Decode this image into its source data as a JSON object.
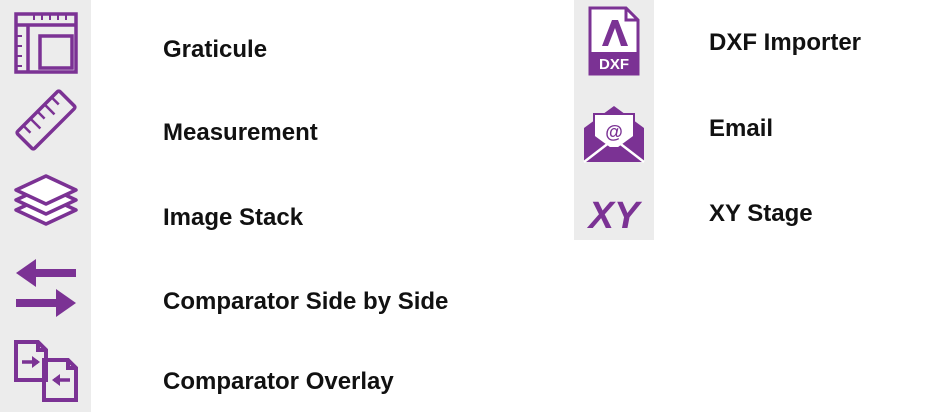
{
  "colors": {
    "accent": "#7b3294",
    "strip": "#ececec",
    "text": "#111111"
  },
  "left_tools": [
    {
      "icon": "graticule-icon",
      "label": "Graticule"
    },
    {
      "icon": "ruler-icon",
      "label": "Measurement"
    },
    {
      "icon": "layers-icon",
      "label": "Image Stack"
    },
    {
      "icon": "swap-arrows-icon",
      "label": "Comparator Side by Side"
    },
    {
      "icon": "overlay-icon",
      "label": "Comparator Overlay"
    }
  ],
  "right_tools": [
    {
      "icon": "dxf-file-icon",
      "label": "DXF Importer",
      "icon_text": "DXF"
    },
    {
      "icon": "email-icon",
      "label": "Email",
      "icon_text": "@"
    },
    {
      "icon": "xy-stage-icon",
      "label": "XY Stage",
      "icon_text": "XY"
    }
  ]
}
